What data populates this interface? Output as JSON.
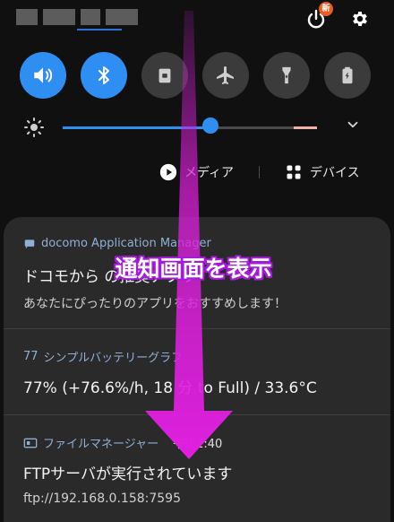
{
  "colors": {
    "accent": "#2f8ef2",
    "badge": "#e85d21",
    "annotation": "#d61fd6"
  },
  "status": {
    "new_badge": "新"
  },
  "quick_tiles": [
    {
      "name": "sound",
      "icon": "volume-icon",
      "active": true
    },
    {
      "name": "bluetooth",
      "icon": "bluetooth-icon",
      "active": true
    },
    {
      "name": "screen-lock",
      "icon": "lock-icon",
      "active": false
    },
    {
      "name": "airplane",
      "icon": "airplane-icon",
      "active": false
    },
    {
      "name": "flashlight",
      "icon": "flashlight-icon",
      "active": false
    },
    {
      "name": "battery-saver",
      "icon": "battery-icon",
      "active": false
    }
  ],
  "brightness": {
    "level": 0.58
  },
  "media": {
    "media_label": "メディア",
    "devices_label": "デバイス"
  },
  "annotation": {
    "text": "通知画面を表示"
  },
  "notifications": [
    {
      "app": "docomo Application Manager",
      "title": "ドコモから の推奨アプリ",
      "body": "あなたにぴったりのアプリをおすすめします！"
    },
    {
      "app": "シンプルバッテリーグラフ",
      "app_prefix": "77",
      "title": "77%  (+76.6%/h,  18 分 to Full)  /  33.6°C"
    },
    {
      "app": "ファイルマネージャー",
      "time": "午後2:40",
      "title": "FTPサーバが実行されています",
      "body": "ftp://192.168.0.158:7595"
    }
  ]
}
